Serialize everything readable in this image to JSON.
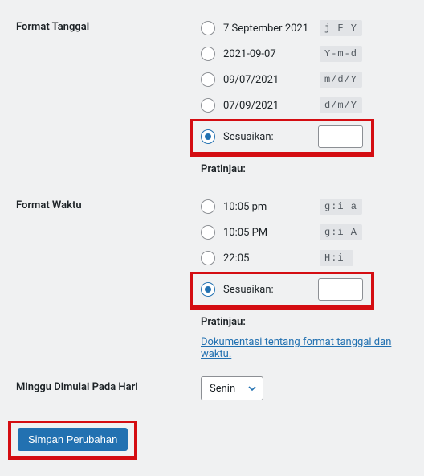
{
  "date_format": {
    "label": "Format Tanggal",
    "options": [
      {
        "label": "7 September 2021",
        "code": "j F Y"
      },
      {
        "label": "2021-09-07",
        "code": "Y-m-d"
      },
      {
        "label": "09/07/2021",
        "code": "m/d/Y"
      },
      {
        "label": "07/09/2021",
        "code": "d/m/Y"
      }
    ],
    "custom_label": "Sesuaikan:",
    "custom_value": "",
    "preview_label": "Pratinjau:"
  },
  "time_format": {
    "label": "Format Waktu",
    "options": [
      {
        "label": "10:05 pm",
        "code": "g:i a"
      },
      {
        "label": "10:05 PM",
        "code": "g:i A"
      },
      {
        "label": "22:05",
        "code": "H:i"
      }
    ],
    "custom_label": "Sesuaikan:",
    "custom_value": "",
    "preview_label": "Pratinjau:",
    "doc_link": "Dokumentasi tentang format tanggal dan waktu."
  },
  "week_start": {
    "label": "Minggu Dimulai Pada Hari",
    "selected": "Senin"
  },
  "save_button": "Simpan Perubahan"
}
